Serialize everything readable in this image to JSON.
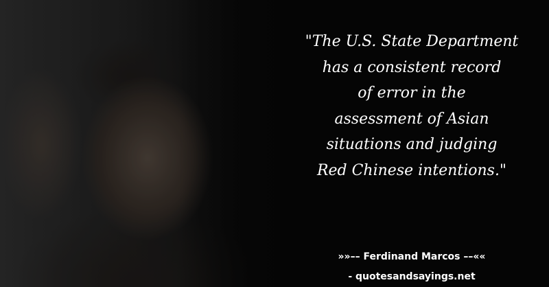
{
  "quote": {
    "lines": [
      "\"The U.S. State Department",
      "has a consistent record",
      "of error in the",
      "assessment of Asian",
      "situations and judging",
      "Red Chinese intentions.\""
    ]
  },
  "attribution": {
    "author_line": "»»–– Ferdinand Marcos ––««",
    "site_line": "- quotesandsayings.net"
  }
}
